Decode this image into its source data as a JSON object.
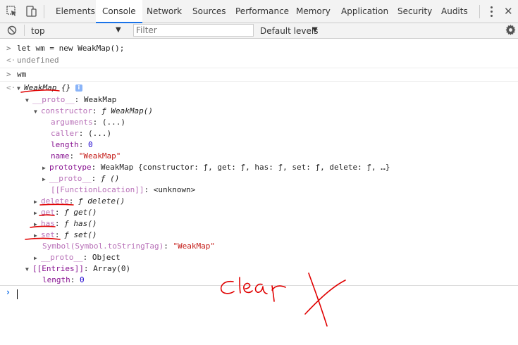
{
  "tabs": [
    {
      "label": "Elements",
      "active": false
    },
    {
      "label": "Console",
      "active": true
    },
    {
      "label": "Network",
      "active": false
    },
    {
      "label": "Sources",
      "active": false
    },
    {
      "label": "Performance",
      "active": false
    },
    {
      "label": "Memory",
      "active": false
    },
    {
      "label": "Application",
      "active": false
    },
    {
      "label": "Security",
      "active": false
    },
    {
      "label": "Audits",
      "active": false
    }
  ],
  "toolbar": {
    "context": "top",
    "filter_placeholder": "Filter",
    "levels": "Default levels"
  },
  "console": {
    "input1": "let wm = new WeakMap();",
    "output1": "undefined",
    "input2": "wm",
    "obj_name": "WeakMap",
    "obj_braces": "{}",
    "proto_key": "__proto__",
    "proto_val": "WeakMap",
    "ctor_key": "constructor",
    "ctor_val": "ƒ WeakMap()",
    "arguments_key": "arguments",
    "arguments_val": "(...)",
    "caller_key": "caller",
    "caller_val": "(...)",
    "length_key": "length",
    "length_val": "0",
    "name_key": "name",
    "name_val": "\"WeakMap\"",
    "prototype_key": "prototype",
    "prototype_val": "WeakMap {constructor: ƒ, get: ƒ, has: ƒ, set: ƒ, delete: ƒ, …}",
    "inner_proto_key": "__proto__",
    "inner_proto_val": "ƒ ()",
    "fnloc_key": "[[FunctionLocation]]",
    "fnloc_val": "<unknown>",
    "delete_key": "delete",
    "delete_val": "ƒ delete()",
    "get_key": "get",
    "get_val": "ƒ get()",
    "has_key": "has",
    "has_val": "ƒ has()",
    "set_key": "set",
    "set_val": "ƒ set()",
    "tostringtag_key": "Symbol(Symbol.toStringTag)",
    "tostringtag_val": "\"WeakMap\"",
    "proto2_key": "__proto__",
    "proto2_val": "Object",
    "entries_key": "[[Entries]]",
    "entries_val": "Array(0)",
    "entries_length_key": "length",
    "entries_length_val": "0"
  },
  "annotation": {
    "handwritten_text": "clear",
    "ink_color": "#e00000"
  },
  "icons": {
    "inspect": "inspect-element-icon",
    "device": "device-toggle-icon",
    "clear": "clear-console-icon",
    "settings": "gear-icon",
    "menu": "kebab-menu-icon",
    "close": "close-icon"
  }
}
